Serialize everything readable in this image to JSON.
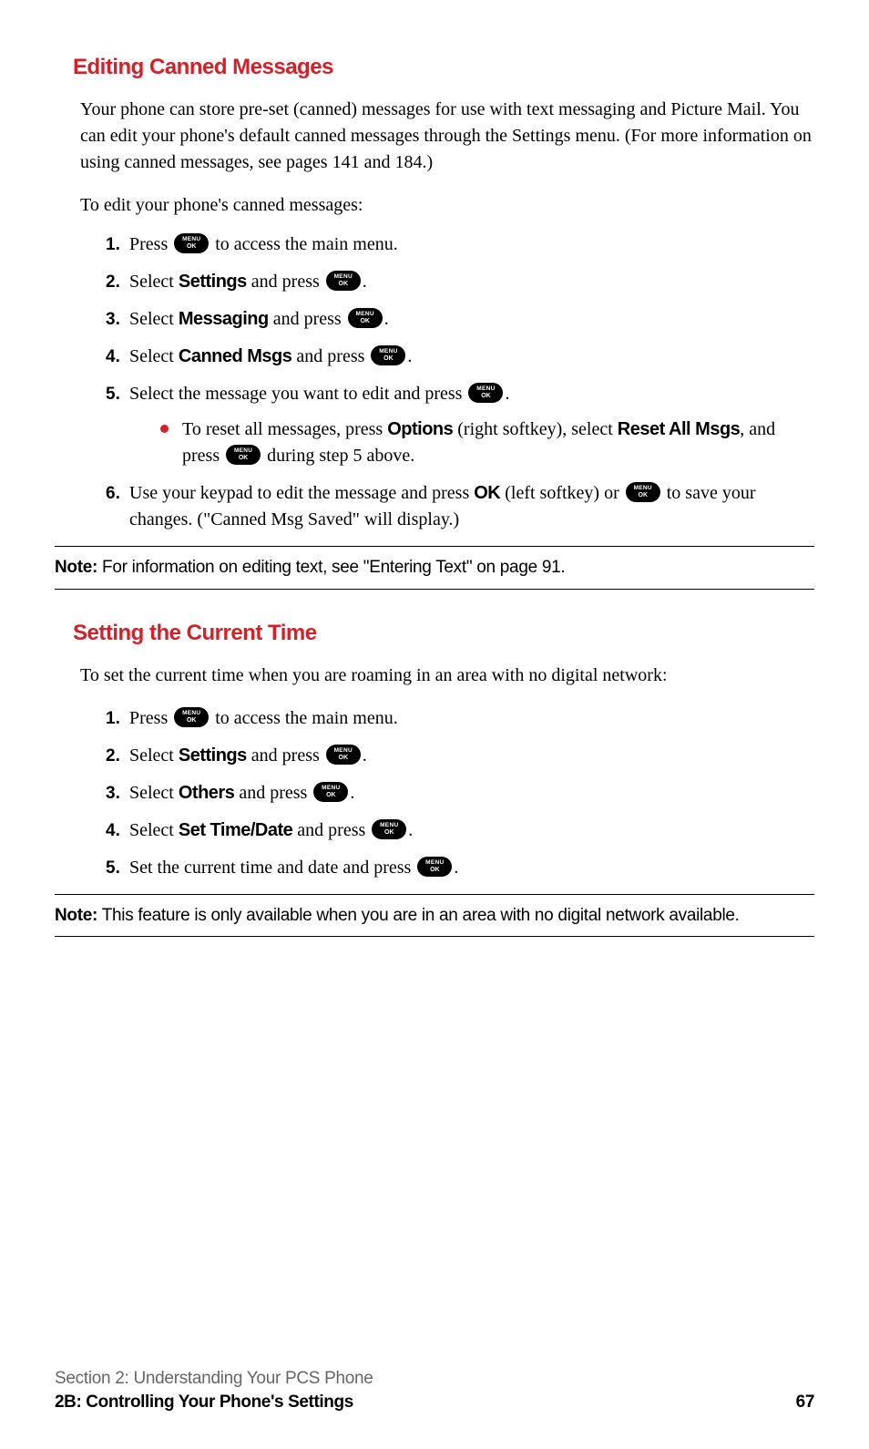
{
  "section1": {
    "heading": "Editing Canned Messages",
    "intro": "Your phone can store pre-set (canned) messages for use with text messaging and Picture Mail. You can edit your phone's default canned messages through the Settings menu. (For more information on using canned messages, see pages 141 and 184.)",
    "lead": "To edit your phone's canned messages:",
    "steps": {
      "s1_a": "Press ",
      "s1_b": " to access the main menu.",
      "s2_a": "Select ",
      "s2_bold": "Settings",
      "s2_b": " and press ",
      "s2_c": ".",
      "s3_a": "Select ",
      "s3_bold": "Messaging",
      "s3_b": " and press ",
      "s3_c": ".",
      "s4_a": "Select ",
      "s4_bold": "Canned Msgs",
      "s4_b": " and press ",
      "s4_c": ".",
      "s5_a": "Select the message you want to edit and press ",
      "s5_b": ".",
      "s5_sub_a": "To reset all messages, press ",
      "s5_sub_bold1": "Options",
      "s5_sub_b": " (right softkey), select ",
      "s5_sub_bold2": "Reset All Msgs",
      "s5_sub_c": ", and press ",
      "s5_sub_d": " during step 5 above.",
      "s6_a": "Use your keypad to edit the message and press ",
      "s6_bold": "OK",
      "s6_b": " (left softkey) or ",
      "s6_c": " to save your changes. (\"Canned Msg Saved\" will display.)"
    },
    "note_label": "Note:",
    "note_text": " For information on editing text, see \"Entering Text\" on page 91."
  },
  "section2": {
    "heading": "Setting the Current Time",
    "intro": "To set the current time when you are roaming in an area with no digital network:",
    "steps": {
      "s1_a": "Press ",
      "s1_b": " to access the main menu.",
      "s2_a": "Select ",
      "s2_bold": "Settings",
      "s2_b": " and press ",
      "s2_c": ".",
      "s3_a": "Select ",
      "s3_bold": "Others",
      "s3_b": " and press ",
      "s3_c": ".",
      "s4_a": "Select ",
      "s4_bold": "Set Time/Date",
      "s4_b": " and press ",
      "s4_c": ".",
      "s5_a": "Set the current time and date and press ",
      "s5_b": "."
    },
    "note_label": "Note:",
    "note_text": " This feature is only available when you are in an area with no digital network available."
  },
  "nums": {
    "n1": "1.",
    "n2": "2.",
    "n3": "3.",
    "n4": "4.",
    "n5": "5.",
    "n6": "6."
  },
  "footer": {
    "line1": "Section 2: Understanding Your PCS Phone",
    "line2": "2B: Controlling Your Phone's Settings",
    "page": "67"
  }
}
